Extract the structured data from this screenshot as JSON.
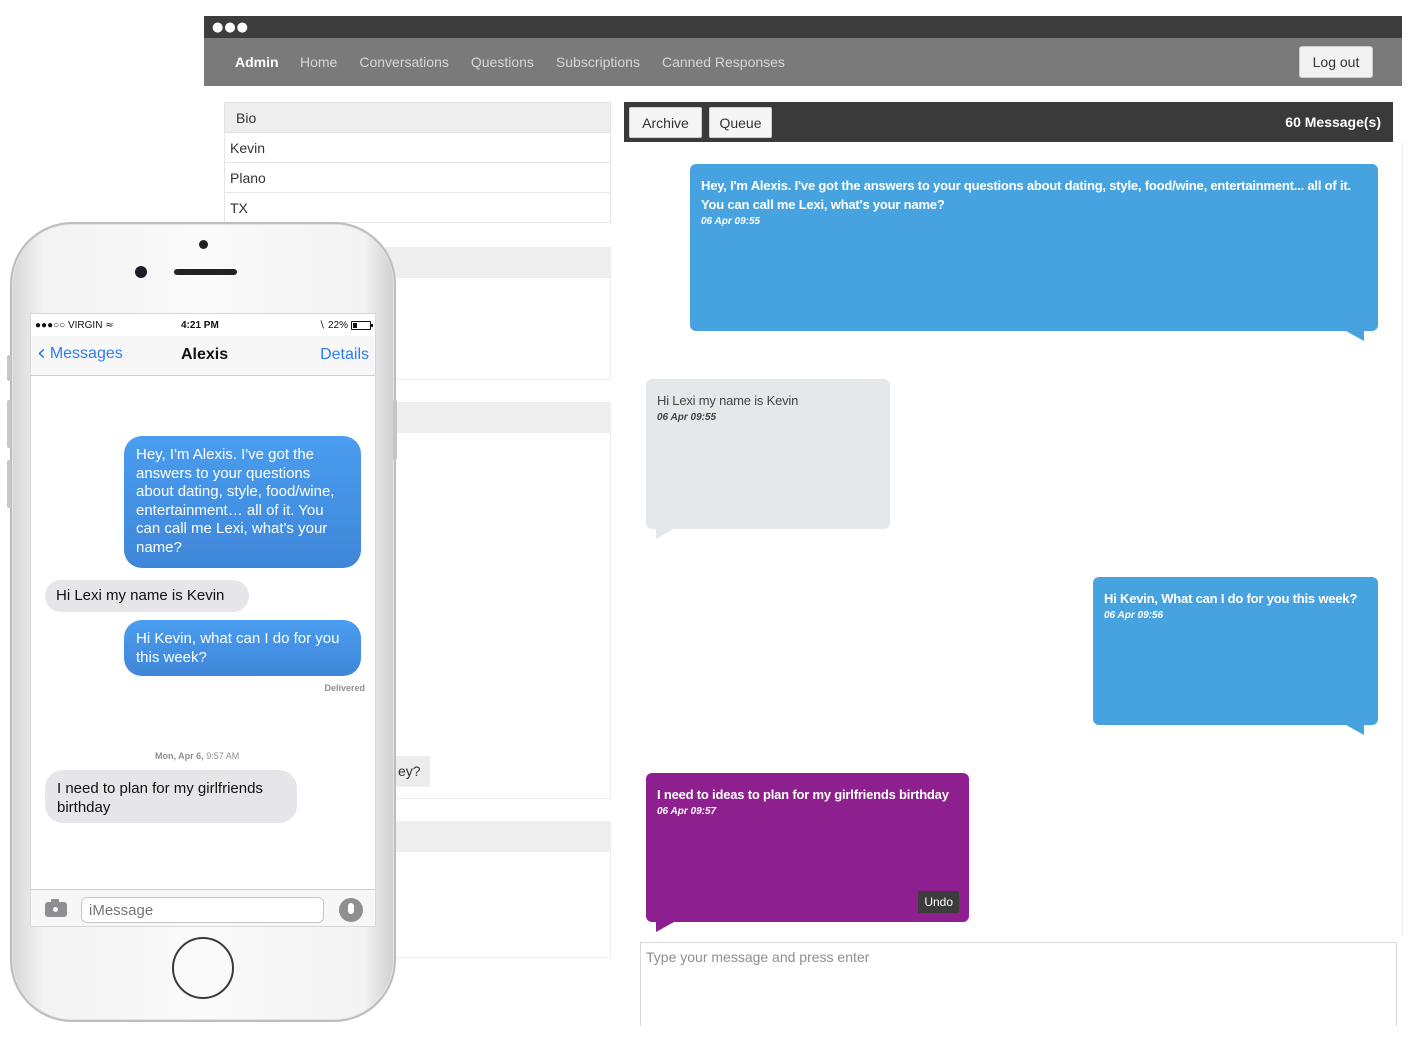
{
  "window": {
    "dots": "●●●"
  },
  "nav": {
    "brand": "Admin",
    "links": [
      "Home",
      "Conversations",
      "Questions",
      "Subscriptions",
      "Canned Responses"
    ],
    "logout": "Log out"
  },
  "bio": {
    "header": "Bio",
    "rows": [
      "Kevin",
      "Plano",
      "TX"
    ]
  },
  "stub": {
    "text": "ey?"
  },
  "chat": {
    "archive_label": "Archive",
    "queue_label": "Queue",
    "count": "60 Message(s)",
    "messages": [
      {
        "text": "Hey, I'm Alexis. I've got the answers to your questions about dating, style, food/wine, entertainment... all of it. You can call me Lexi, what's your name?",
        "time": "06 Apr 09:55"
      },
      {
        "text": "Hi Lexi my name is Kevin",
        "time": "06 Apr 09:55"
      },
      {
        "text": "Hi Kevin, What can I do for you this week?",
        "time": "06 Apr 09:56"
      },
      {
        "text": "I need to ideas to plan for my girlfriends birthday",
        "time": "06 Apr 09:57",
        "action": "Undo"
      }
    ],
    "composer_placeholder": "Type your message and press enter",
    "colors": {
      "outgoing": "#47a3df",
      "incoming": "#e5e8eb",
      "pending": "#8e1f8e"
    }
  },
  "phone": {
    "status": {
      "carrier": "●●●○○ VIRGIN",
      "time": "4:21 PM",
      "battery": "22%"
    },
    "nav": {
      "back": "Messages",
      "title": "Alexis",
      "details": "Details"
    },
    "messages": [
      {
        "text": "Hey, I'm Alexis. I've got the answers to your questions about dating, style, food/wine, entertainment… all of it. You can call me Lexi, what's your name?"
      },
      {
        "text": "Hi Lexi my name is Kevin"
      },
      {
        "text": "Hi Kevin, what can I do for you this week?"
      },
      {
        "text": "I need to plan for my girlfriends birthday"
      }
    ],
    "delivered": "Delivered",
    "date_header_day": "Mon, Apr 6,",
    "date_header_time": "9:57 AM",
    "input_placeholder": "iMessage",
    "icons": [
      "camera-icon",
      "microphone-icon",
      "chevron-left-icon",
      "wifi-icon",
      "bluetooth-icon",
      "battery-icon"
    ]
  }
}
